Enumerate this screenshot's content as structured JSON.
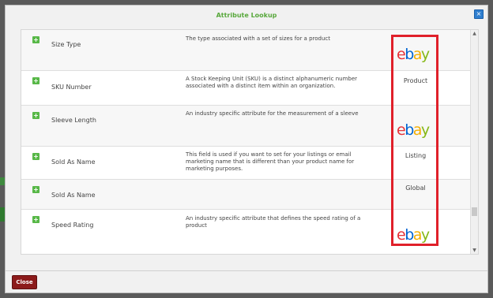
{
  "dialog": {
    "title": "Attribute Lookup",
    "close_x": "×",
    "close_button": "Close"
  },
  "rows": [
    {
      "name": "Size Type",
      "description": "The type associated with a set of sizes for a product",
      "source": "",
      "logo": "ebay"
    },
    {
      "name": "SKU Number",
      "description": "A Stock Keeping Unit (SKU) is a distinct alphanumeric number associated with a distinct item within an organization.",
      "source": "Product",
      "logo": ""
    },
    {
      "name": "Sleeve Length",
      "description": "An industry specific attribute for the measurement of a sleeve",
      "source": "",
      "logo": "ebay"
    },
    {
      "name": "Sold As Name",
      "description": "This field is used if you want to set for your listings or email marketing name that is different than your product name for marketing purposes.",
      "source": "Listing",
      "logo": ""
    },
    {
      "name": "Sold As Name",
      "description": "",
      "source": "Global",
      "logo": ""
    },
    {
      "name": "Speed Rating",
      "description": "An industry specific attribute that defines the speed rating of a product",
      "source": "",
      "logo": "ebay"
    }
  ],
  "logo_text": {
    "e": "e",
    "b": "b",
    "a": "a",
    "y": "y"
  },
  "plus_icon": "+",
  "highlight_color": "#e0202a"
}
